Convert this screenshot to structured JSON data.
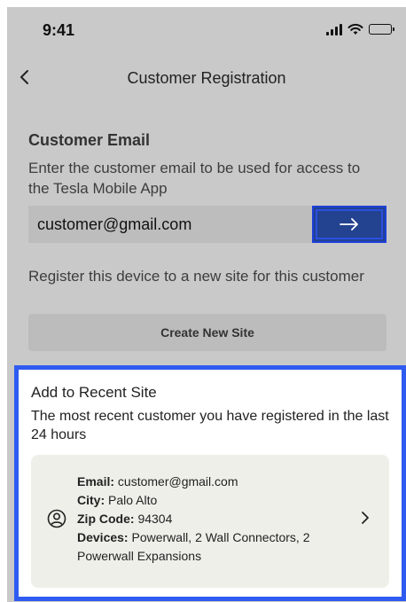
{
  "status_bar": {
    "time": "9:41",
    "icons": [
      "signal-icon",
      "wifi-icon",
      "battery-icon"
    ]
  },
  "header": {
    "title": "Customer Registration",
    "back_icon": "chevron-left-icon"
  },
  "email_section": {
    "title": "Customer Email",
    "description": "Enter the customer email to be used for access to the Tesla Mobile App",
    "input_value": "customer@gmail.com",
    "submit_icon": "arrow-right-icon"
  },
  "new_site_section": {
    "description": "Register this device to a new site for this customer",
    "button_label": "Create New Site"
  },
  "recent_site": {
    "title": "Add to Recent Site",
    "description": "The most recent customer you have registered in the last 24 hours",
    "card": {
      "icon": "user-circle-icon",
      "email_label": "Email:",
      "email_value": "customer@gmail.com",
      "city_label": "City:",
      "city_value": "Palo Alto",
      "zip_label": "Zip Code:",
      "zip_value": "94304",
      "devices_label": "Devices:",
      "devices_value": "Powerwall, 2 Wall Connectors, 2 Powerwall Expansions",
      "chevron_icon": "chevron-right-icon"
    }
  },
  "colors": {
    "overlay": "#c9c9c9",
    "accent_blue": "#2f5bf0",
    "submit_button": "#23428f",
    "card_background": "#efefea"
  }
}
